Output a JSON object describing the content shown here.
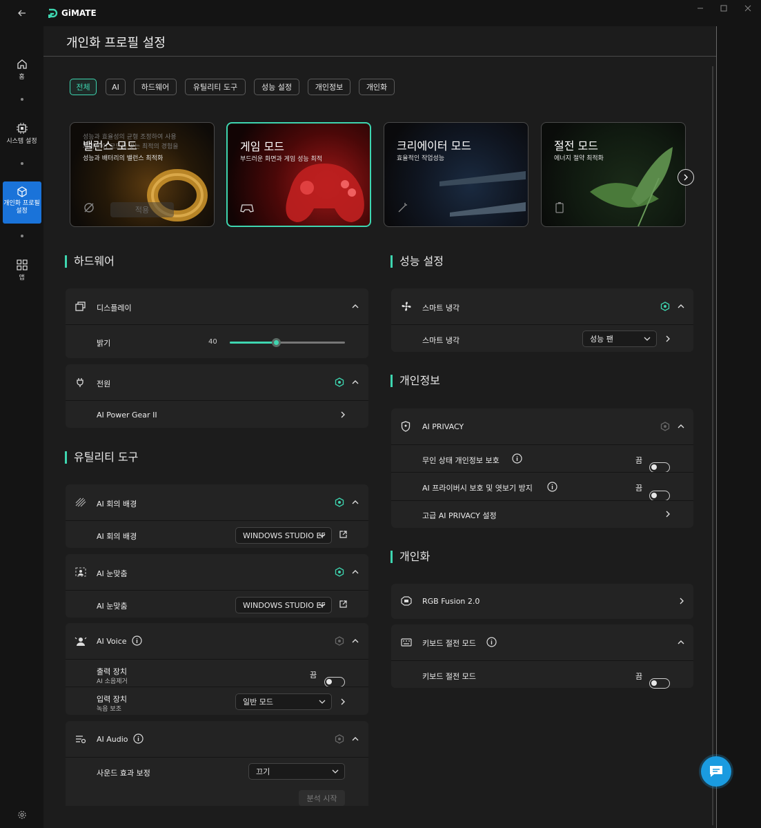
{
  "app": {
    "logo_text": "GiMATE"
  },
  "nav": [
    {
      "label": "홈"
    },
    {
      "label": "시스템 설정"
    },
    {
      "label": "개인화 프로필 설정"
    },
    {
      "label": "앱"
    }
  ],
  "page": {
    "title": "개인화 프로필 설정"
  },
  "filters": [
    "전체",
    "AI",
    "하드웨어",
    "유틸리티 도구",
    "성능 설정",
    "개인정보",
    "개인화"
  ],
  "modes": [
    {
      "title": "밸런스 모드",
      "subtitle": "성능과 배터리의 밸런스 최적화",
      "overlay": "성능과 효율성의 균형 조정하여 사용\n자에게 이 모드를 맞는 최적의 경험을",
      "apply": "적용"
    },
    {
      "title": "게임 모드",
      "subtitle": "부드러운 화면과 게임 성능 최적"
    },
    {
      "title": "크리에이터 모드",
      "subtitle": "효율적인 작업성능"
    },
    {
      "title": "절전 모드",
      "subtitle": "에너지 절약 최적화"
    }
  ],
  "hardware": {
    "title": "하드웨어",
    "display": {
      "label": "디스플레이",
      "brightness_label": "밝기",
      "brightness_value": "40",
      "brightness": 40
    },
    "power": {
      "label": "전원",
      "item": "AI Power Gear II"
    }
  },
  "utility": {
    "title": "유틸리티 도구",
    "meeting": {
      "label": "AI 회의 배경",
      "row": "AI 회의 배경",
      "value": "WINDOWS STUDIO EF"
    },
    "eye": {
      "label": "AI 눈맞춤",
      "row": "AI 눈맞춤",
      "value": "WINDOWS STUDIO EF"
    },
    "voice": {
      "label": "AI Voice",
      "out_label": "출력 장치",
      "out_sub": "AI 소음제거",
      "out_state": "끔",
      "in_label": "입력 장치",
      "in_sub": "녹음 보조",
      "in_value": "일반 모드"
    },
    "audio": {
      "label": "AI Audio",
      "row": "사운드 효과 보정",
      "value": "끄기",
      "button": "분석 시작"
    }
  },
  "performance": {
    "title": "성능 설정",
    "cooling": {
      "label": "스마트 냉각",
      "row": "스마트 냉각",
      "value": "성능 팬"
    }
  },
  "privacy": {
    "title": "개인정보",
    "ai": {
      "label": "AI PRIVACY",
      "row1": "무인 상태 개인정보 보호",
      "row1_state": "끔",
      "row2": "AI 프라이버시 보호 및 엿보기 방지",
      "row2_state": "끔",
      "row3": "고급 AI PRIVACY 설정"
    }
  },
  "personal": {
    "title": "개인화",
    "rgb": {
      "label": "RGB Fusion 2.0"
    },
    "kb": {
      "label": "키보드 절전 모드",
      "row": "키보드 절전 모드",
      "state": "끔"
    }
  },
  "colors": {
    "accent": "#3ed6b0",
    "chat": "#1a9be0"
  }
}
